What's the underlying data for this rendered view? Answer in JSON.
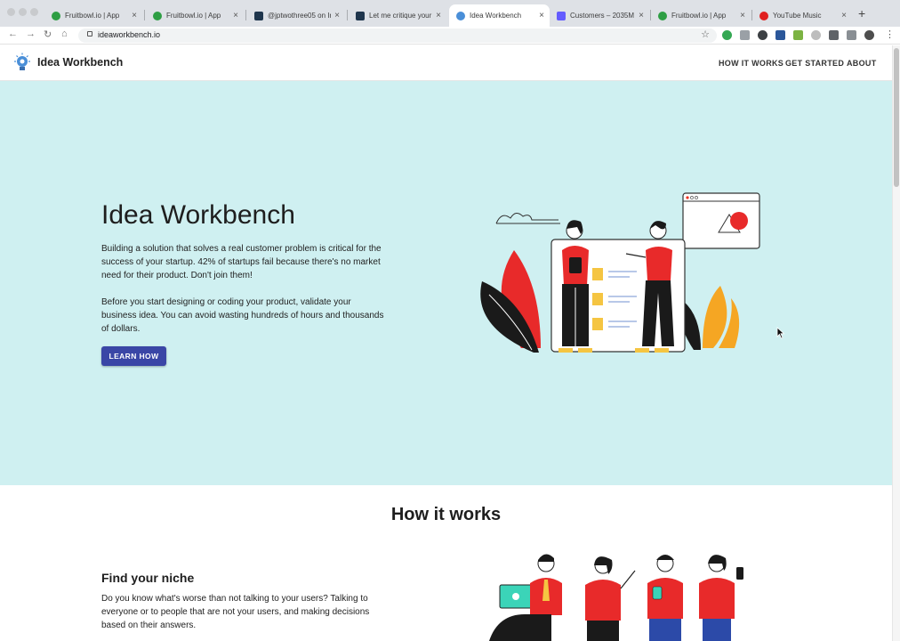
{
  "browser": {
    "tabs": [
      {
        "title": "Fruitbowl.io | App",
        "favicon": "fruitbowl-icon",
        "color": "#2e9e44"
      },
      {
        "title": "Fruitbowl.io | App",
        "favicon": "fruitbowl-icon",
        "color": "#2e9e44"
      },
      {
        "title": "@jptwothree05 on In",
        "favicon": "indiehackers-icon",
        "color": "#1f364d"
      },
      {
        "title": "Let me critique your",
        "favicon": "indiehackers-icon",
        "color": "#1f364d"
      },
      {
        "title": "Idea Workbench",
        "favicon": "bulb-icon",
        "color": "#4a8fd8",
        "active": true
      },
      {
        "title": "Customers – 2035M",
        "favicon": "stripe-icon",
        "color": "#635bff"
      },
      {
        "title": "Fruitbowl.io | App",
        "favicon": "fruitbowl-icon",
        "color": "#2e9e44"
      },
      {
        "title": "YouTube Music",
        "favicon": "youtube-music-icon",
        "color": "#e02020"
      }
    ],
    "new_tab": "+",
    "url": "ideaworkbench.io"
  },
  "header": {
    "brand": "Idea Workbench",
    "nav": [
      "HOW IT WORKS",
      "GET STARTED",
      "ABOUT"
    ]
  },
  "hero": {
    "title": "Idea Workbench",
    "paragraph1": "Building a solution that solves a real customer problem is critical for the success of your startup. 42% of startups fail because there's no market need for their product. Don't join them!",
    "paragraph2": "Before you start designing or coding your product, validate your business idea. You can avoid wasting hundreds of hours and thousands of dollars.",
    "cta": "LEARN HOW",
    "background": "#cff0f1",
    "accent": "#3a46a6"
  },
  "how_it_works": {
    "title": "How it works",
    "step1_title": "Find your niche",
    "step1_text": "Do you know what's worse than not talking to your users? Talking to everyone or to people that are not your users, and making decisions based on their answers."
  }
}
